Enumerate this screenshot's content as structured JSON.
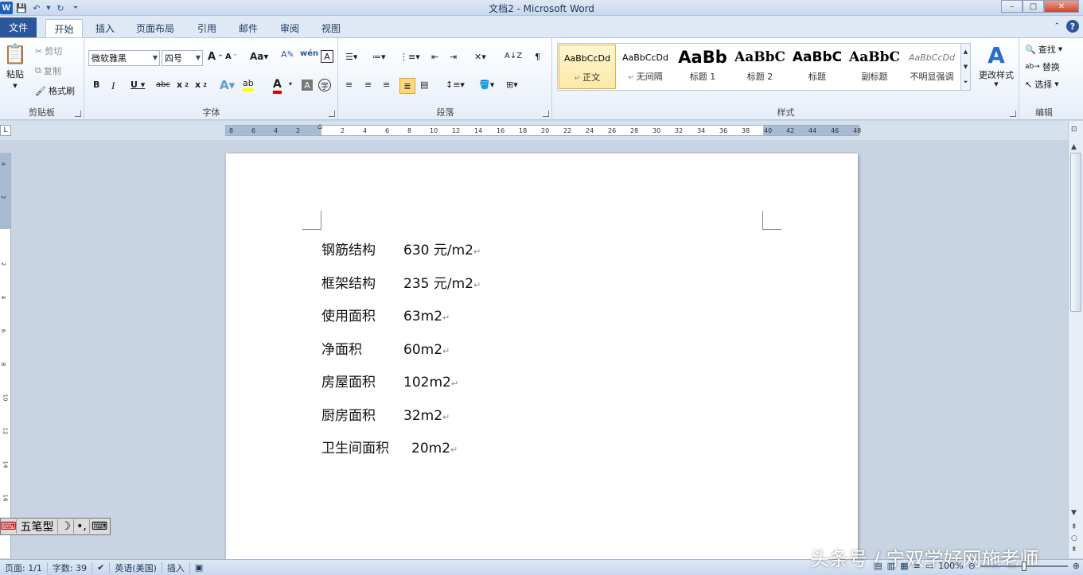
{
  "window": {
    "title": "文档2 - Microsoft Word",
    "controls": [
      "–",
      "□",
      "✕"
    ]
  },
  "tabs": [
    "文件",
    "开始",
    "插入",
    "页面布局",
    "引用",
    "邮件",
    "审阅",
    "视图"
  ],
  "clipboard": {
    "paste": "粘贴",
    "cut": "剪切",
    "copy": "复制",
    "format_painter": "格式刷",
    "label": "剪贴板"
  },
  "font": {
    "name": "微软雅黑",
    "size": "四号",
    "label": "字体"
  },
  "paragraph": {
    "label": "段落"
  },
  "styles": {
    "items": [
      {
        "preview": "AaBbCcDd",
        "name": "正文"
      },
      {
        "preview": "AaBbCcDd",
        "name": "无间隔"
      },
      {
        "preview": "AaBb",
        "name": "标题 1"
      },
      {
        "preview": "AaBbC",
        "name": "标题 2"
      },
      {
        "preview": "AaBbC",
        "name": "标题"
      },
      {
        "preview": "AaBbC",
        "name": "副标题"
      },
      {
        "preview": "AaBbCcDd",
        "name": "不明显强调"
      }
    ],
    "change_styles": "更改样式",
    "label": "样式"
  },
  "editing": {
    "find": "查找",
    "replace": "替换",
    "select": "选择",
    "label": "编辑"
  },
  "ruler": {
    "ticks": [
      "8",
      "6",
      "4",
      "2",
      "",
      "2",
      "4",
      "6",
      "8",
      "10",
      "12",
      "14",
      "16",
      "18",
      "20",
      "22",
      "24",
      "26",
      "28",
      "30",
      "32",
      "34",
      "36",
      "38",
      "40",
      "42",
      "44",
      "46",
      "48"
    ],
    "vticks": [
      "4",
      "2",
      "",
      "2",
      "4",
      "6",
      "8",
      "10",
      "12",
      "14",
      "16"
    ]
  },
  "document": {
    "lines": [
      {
        "label": "钢筋结构",
        "value": "630 元/m2"
      },
      {
        "label": "框架结构",
        "value": "235 元/m2"
      },
      {
        "label": "使用面积",
        "value": "63m2"
      },
      {
        "label": "净面积",
        "value": "60m2"
      },
      {
        "label": "房屋面积",
        "value": "102m2"
      },
      {
        "label": "厨房面积",
        "value": "32m2"
      },
      {
        "label": "卫生间面积",
        "value": "20m2"
      }
    ],
    "para_mark": "↵"
  },
  "ime": {
    "mode": "五笔型"
  },
  "status": {
    "page": "页面: 1/1",
    "words": "字数: 39",
    "language": "英语(美国)",
    "insert": "插入",
    "zoom": "100%"
  },
  "watermark": "头条号 / 宁双学好网施老师"
}
